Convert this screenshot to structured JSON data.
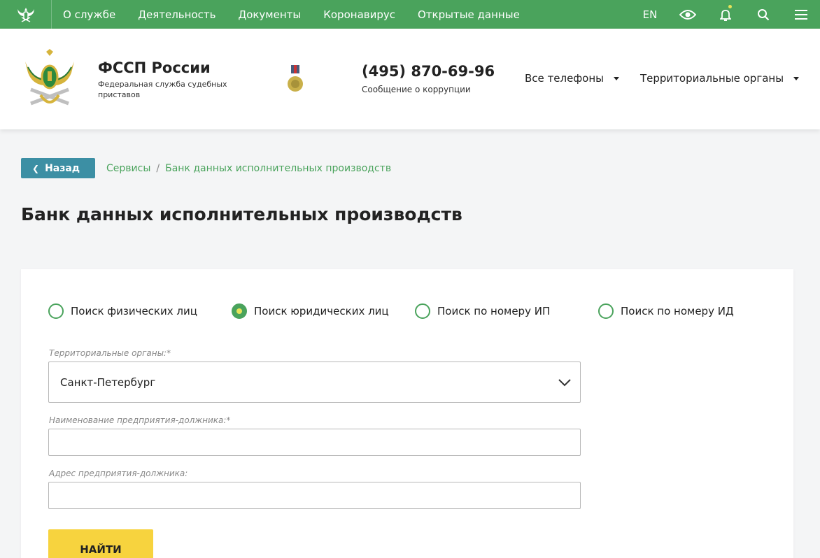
{
  "topnav": {
    "items": [
      "О службе",
      "Деятельность",
      "Документы",
      "Коронавирус",
      "Открытые данные"
    ],
    "lang": "EN",
    "bg_color": "#4aa35c",
    "icons": [
      "eagle-emblem-icon",
      "eye-icon",
      "bell-icon",
      "search-icon",
      "menu-icon"
    ]
  },
  "header": {
    "org_name": "ФССП России",
    "org_subtitle": "Федеральная служба судебных приставов",
    "phone": "(495) 870-69-96",
    "phone_caption": "Сообщение о коррупции",
    "phones_dropdown": "Все телефоны",
    "territorial_dropdown": "Территориальные органы"
  },
  "breadcrumb": {
    "back_label": "Назад",
    "items": [
      "Сервисы",
      "Банк данных исполнительных производств"
    ],
    "separator": "/"
  },
  "page": {
    "title": "Банк данных исполнительных производств"
  },
  "search": {
    "modes": [
      {
        "label": "Поиск физических лиц",
        "selected": false
      },
      {
        "label": "Поиск юридических лиц",
        "selected": true
      },
      {
        "label": "Поиск по номеру ИП",
        "selected": false
      },
      {
        "label": "Поиск по номеру ИД",
        "selected": false
      }
    ],
    "region_label": "Территориальные органы:*",
    "region_value": "Санкт-Петербург",
    "name_label": "Наименование предприятия-должника:*",
    "name_value": "",
    "address_label": "Адрес предприятия-должника:",
    "address_value": "",
    "submit_label": "НАЙТИ"
  },
  "colors": {
    "accent_green": "#4aa35c",
    "back_button": "#3c8fa4",
    "submit_button": "#f7d33e"
  }
}
